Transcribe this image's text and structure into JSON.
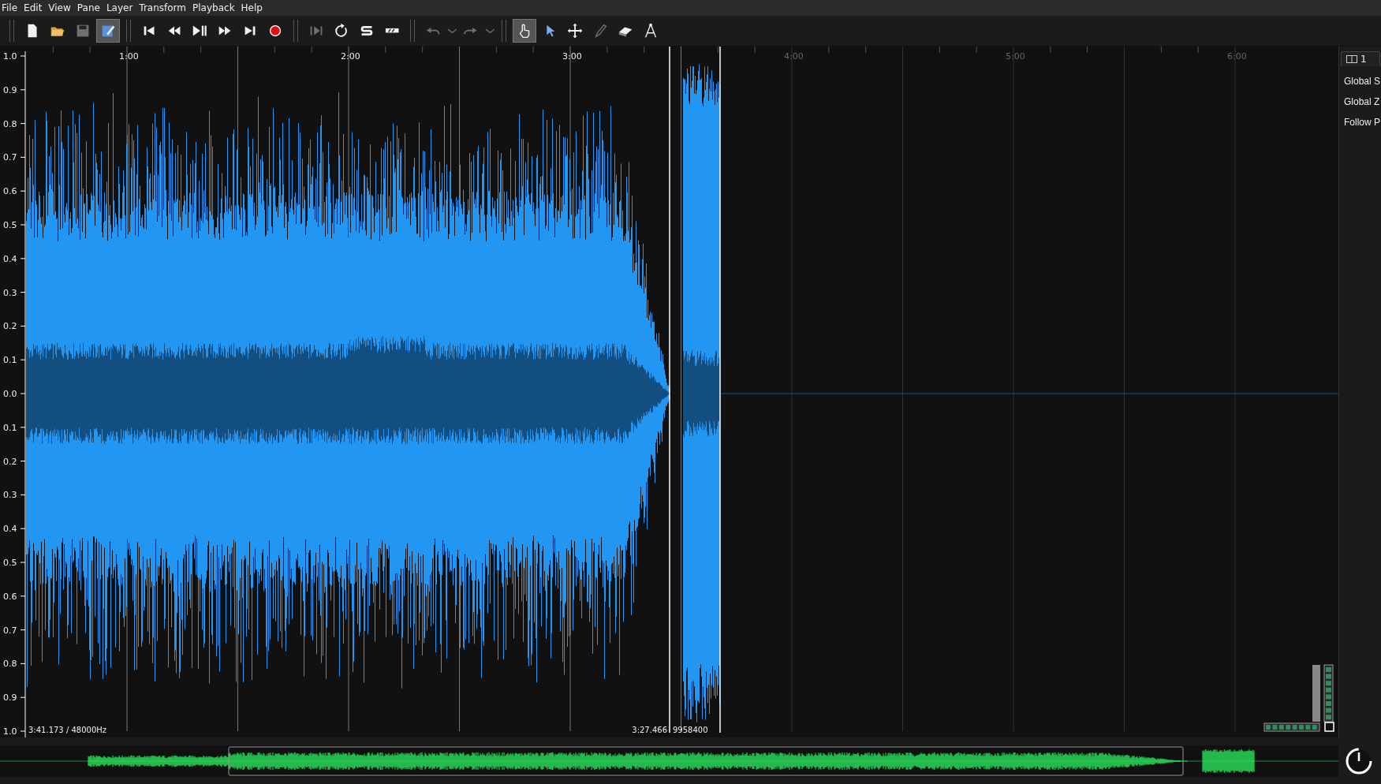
{
  "menu": [
    "File",
    "Edit",
    "View",
    "Pane",
    "Layer",
    "Transform",
    "Playback",
    "Help"
  ],
  "toolbar": [
    [
      {
        "kind": "new",
        "selected": false,
        "disabled": false
      },
      {
        "kind": "open",
        "selected": false,
        "disabled": false
      },
      {
        "kind": "save",
        "selected": false,
        "disabled": true
      },
      {
        "kind": "annotate",
        "selected": true,
        "disabled": false
      }
    ],
    [
      {
        "kind": "to-start",
        "selected": false,
        "disabled": false
      },
      {
        "kind": "rewind",
        "selected": false,
        "disabled": false
      },
      {
        "kind": "play-pause",
        "selected": false,
        "disabled": false
      },
      {
        "kind": "fast-forward",
        "selected": false,
        "disabled": false
      },
      {
        "kind": "to-end",
        "selected": false,
        "disabled": false
      },
      {
        "kind": "record",
        "selected": false,
        "disabled": false
      }
    ],
    [
      {
        "kind": "play-selection",
        "selected": false,
        "disabled": true
      },
      {
        "kind": "loop",
        "selected": false,
        "disabled": false
      },
      {
        "kind": "solo",
        "selected": false,
        "disabled": false
      },
      {
        "kind": "speed",
        "selected": false,
        "disabled": false
      }
    ],
    [
      {
        "kind": "undo",
        "selected": false,
        "disabled": true
      },
      {
        "kind": "dropdown",
        "selected": false,
        "disabled": true
      },
      {
        "kind": "redo",
        "selected": false,
        "disabled": true
      },
      {
        "kind": "dropdown",
        "selected": false,
        "disabled": true
      }
    ],
    [
      {
        "kind": "navigate",
        "selected": true,
        "disabled": false
      },
      {
        "kind": "select",
        "selected": false,
        "disabled": false
      },
      {
        "kind": "move",
        "selected": false,
        "disabled": false
      },
      {
        "kind": "draw",
        "selected": false,
        "disabled": true
      },
      {
        "kind": "erase",
        "selected": false,
        "disabled": false
      },
      {
        "kind": "measure",
        "selected": false,
        "disabled": false
      }
    ]
  ],
  "pane": {
    "vertical_scale": [
      "1.0",
      "0.9",
      "0.8",
      "0.7",
      "0.6",
      "0.5",
      "0.4",
      "0.3",
      "0.2",
      "0.1",
      "0.0",
      "0.1",
      "0.2",
      "0.3",
      "0.4",
      "0.5",
      "0.6",
      "0.7",
      "0.8",
      "0.9",
      "1.0"
    ],
    "time_ruler": [
      "1:00",
      "2:00",
      "3:00",
      "4:00",
      "5:00",
      "6:00"
    ],
    "status": "3:41.173 / 48000Hz",
    "cursor_time": "3:27.466",
    "cursor_frame": "9958400"
  },
  "property_panel": {
    "tab": "1",
    "items": [
      "Global S",
      "Global Z",
      "Follow P"
    ]
  }
}
